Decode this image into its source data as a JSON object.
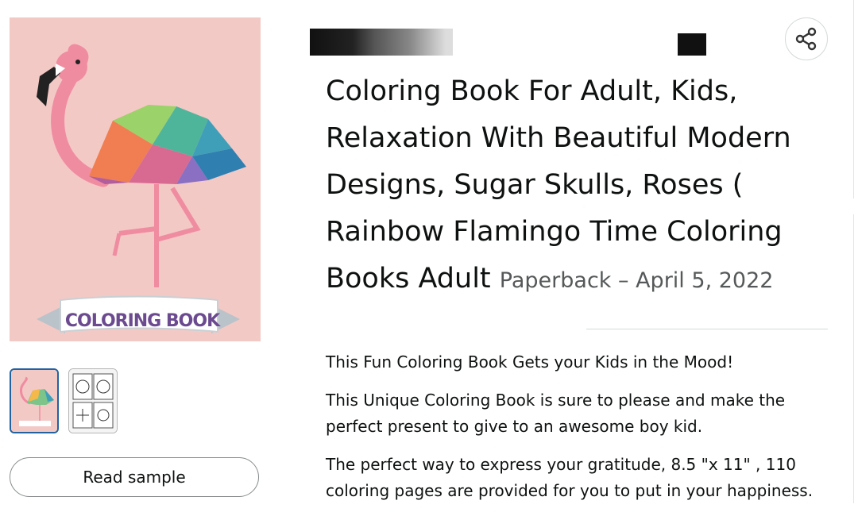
{
  "product": {
    "title": "Coloring Book For Adult, Kids, Relaxation With Beautiful Modern Designs, Sugar Skulls, Roses ( Rainbow Flamingo Time Coloring Books Adult",
    "format": "Paperback – April 5, 2022"
  },
  "cover": {
    "banner_text": "COLORING BOOK",
    "background_color": "#f3c9c6"
  },
  "actions": {
    "read_sample_label": "Read sample",
    "share_icon": "share-icon"
  },
  "description": [
    "This Fun Coloring Book Gets your Kids in the Mood!",
    "This Unique Coloring Book is sure to please and make the perfect present to give to an awesome boy kid.",
    "The perfect way to express your gratitude, 8.5 \"x 11\" , 110 coloring pages are provided for you to put in your happiness."
  ],
  "thumbnails": [
    {
      "name": "cover-thumbnail",
      "selected": true
    },
    {
      "name": "interior-pages-thumbnail",
      "selected": false
    }
  ]
}
